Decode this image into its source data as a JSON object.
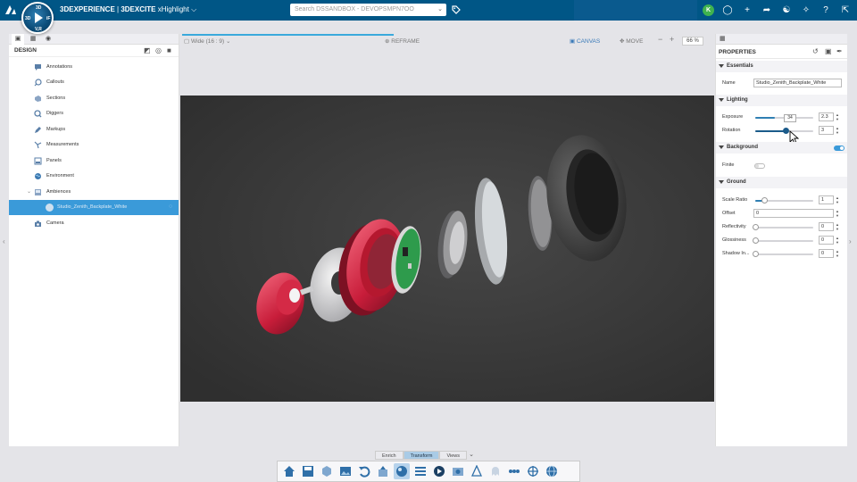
{
  "app": {
    "brand_prefix": "3DEXPERIENCE",
    "brand_separator": " | ",
    "brand_company": "3DEXCITE",
    "app_name": "xHighlight",
    "user_initial": "K",
    "compass": {
      "north": "3D",
      "west": "3D",
      "east": "iF",
      "south": "V,R"
    }
  },
  "search": {
    "placeholder": "Search DSSANDBOX - DEVOPSMPN7OO"
  },
  "colors": {
    "topbar": "#005686",
    "accent": "#3a9ad9",
    "avatar": "#3fb34f"
  },
  "left_panel": {
    "title": "DESIGN",
    "items": [
      {
        "label": "Annotations",
        "icon": "annotation-icon"
      },
      {
        "label": "Callouts",
        "icon": "callout-icon"
      },
      {
        "label": "Sections",
        "icon": "section-icon"
      },
      {
        "label": "Diggers",
        "icon": "digger-icon"
      },
      {
        "label": "Markups",
        "icon": "markup-icon"
      },
      {
        "label": "Measurements",
        "icon": "measurement-icon"
      },
      {
        "label": "Panels",
        "icon": "panel-icon"
      },
      {
        "label": "Environment",
        "icon": "environment-icon"
      },
      {
        "label": "Ambiences",
        "icon": "ambience-icon"
      },
      {
        "label": "Studio_Zenith_Backplate_White",
        "icon": "studio-icon",
        "selected": true
      },
      {
        "label": "Camera",
        "icon": "camera-icon"
      }
    ]
  },
  "canvas_toolbar": {
    "aspect": "Wide (16 : 9)",
    "reframe": "REFRAME",
    "canvas": "CANVAS",
    "move": "MOVE",
    "zoom": "66 %"
  },
  "properties": {
    "title": "PROPERTIES",
    "essentials": {
      "title": "Essentials",
      "name_label": "Name",
      "name_value": "Studio_Zenith_Backplate_White"
    },
    "lighting": {
      "title": "Lighting",
      "exposure": {
        "label": "Exposure",
        "value": "2.3",
        "tooltip": "34",
        "level": 0.34
      },
      "rotation": {
        "label": "Rotation",
        "value": "3",
        "level": 0.52
      }
    },
    "background": {
      "title": "Background",
      "enabled": true,
      "finite_label": "Finite",
      "finite": false
    },
    "ground": {
      "title": "Ground",
      "scale_ratio": {
        "label": "Scale Ratio",
        "value": "1",
        "level": 0.15
      },
      "offset": {
        "label": "Offset",
        "value": "0"
      },
      "reflectivity": {
        "label": "Reflectivity",
        "value": "0",
        "level": 0
      },
      "glossiness": {
        "label": "Glossiness",
        "value": "0",
        "level": 0
      },
      "shadow": {
        "label": "Shadow In...",
        "value": "0",
        "level": 0
      }
    }
  },
  "action_bar": {
    "tabs": [
      "Enrich",
      "Transform",
      "Views"
    ],
    "active_tab": "Transform",
    "icons": [
      "home-icon",
      "save-icon",
      "import-icon",
      "image-icon",
      "undo-icon",
      "share-icon",
      "render-icon",
      "list-icon",
      "play-icon",
      "snapshot-icon",
      "cone-icon",
      "ghost-icon",
      "connect-icon",
      "compass-tool-icon",
      "globe-icon"
    ]
  }
}
